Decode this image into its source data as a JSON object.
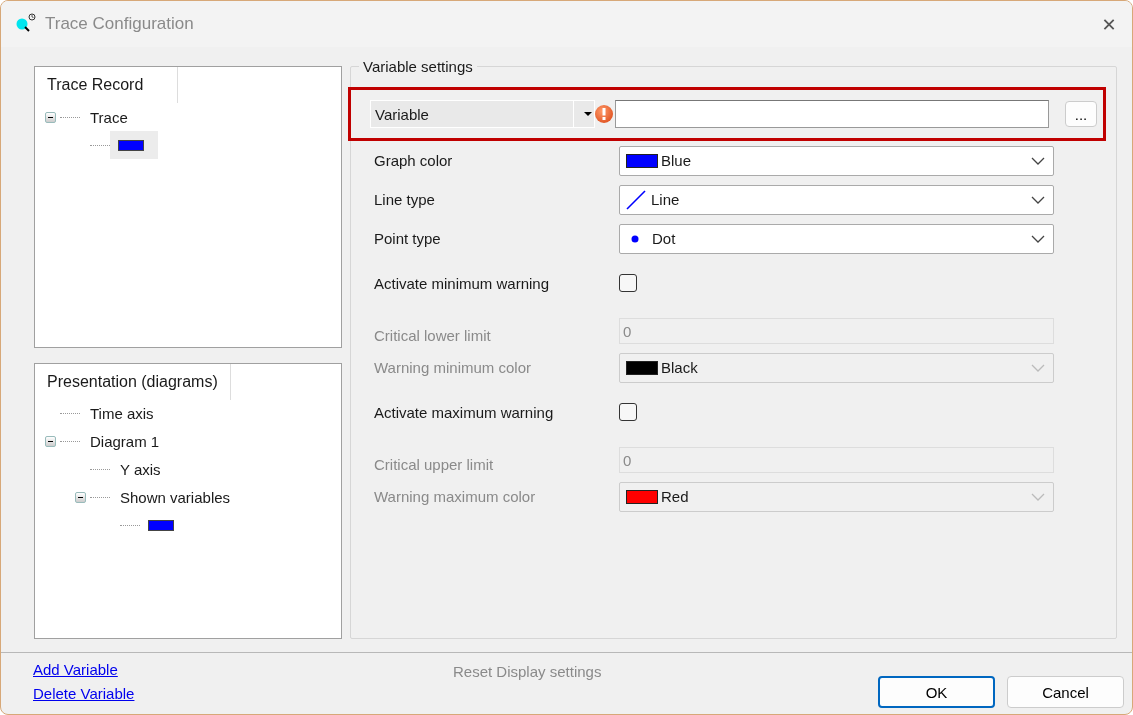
{
  "window": {
    "title": "Trace Configuration",
    "close": "✕"
  },
  "trees": [
    {
      "header": "Trace Record",
      "items": [
        {
          "kind": "text",
          "label": "Trace",
          "expanded": true,
          "selected": false,
          "children": [
            {
              "kind": "swatch",
              "color": "#0000ff",
              "selected": true
            }
          ]
        }
      ]
    },
    {
      "header": "Presentation (diagrams)",
      "items": [
        {
          "kind": "text",
          "label": "Time axis",
          "selected": false
        },
        {
          "kind": "text",
          "label": "Diagram 1",
          "expanded": true,
          "selected": false,
          "children": [
            {
              "kind": "text",
              "label": "Y axis",
              "selected": false
            },
            {
              "kind": "text",
              "label": "Shown variables",
              "expanded": true,
              "selected": false,
              "children": [
                {
                  "kind": "swatch",
                  "color": "#0000ff",
                  "selected": false
                }
              ]
            }
          ]
        }
      ]
    }
  ],
  "settings": {
    "title": "Variable settings",
    "rows": [
      {
        "kind": "variable",
        "label": "Variable",
        "error": true,
        "highlighted": true,
        "browse": "..."
      },
      {
        "kind": "color-select",
        "label": "Graph color",
        "value": "Blue",
        "color": "#0000ff",
        "disabled": false
      },
      {
        "kind": "line-select",
        "label": "Line type",
        "value": "Line",
        "disabled": false
      },
      {
        "kind": "dot-select",
        "label": "Point type",
        "value": "Dot",
        "disabled": false
      },
      {
        "kind": "checkbox",
        "label": "Activate minimum warning",
        "checked": false
      },
      {
        "kind": "text",
        "label": "Critical lower limit",
        "value": "0",
        "disabled": true
      },
      {
        "kind": "color-select",
        "label": "Warning minimum color",
        "value": "Black",
        "color": "#000000",
        "disabled": true
      },
      {
        "kind": "checkbox",
        "label": "Activate maximum warning",
        "checked": false
      },
      {
        "kind": "text",
        "label": "Critical upper limit",
        "value": "0",
        "disabled": true
      },
      {
        "kind": "color-select",
        "label": "Warning maximum color",
        "value": "Red",
        "color": "#ff0000",
        "disabled": true
      }
    ]
  },
  "footer": {
    "links": [
      "Add Variable",
      "Delete Variable"
    ],
    "reset": "Reset Display settings",
    "buttons": [
      {
        "label": "OK",
        "default": true
      },
      {
        "label": "Cancel",
        "default": false
      }
    ]
  }
}
